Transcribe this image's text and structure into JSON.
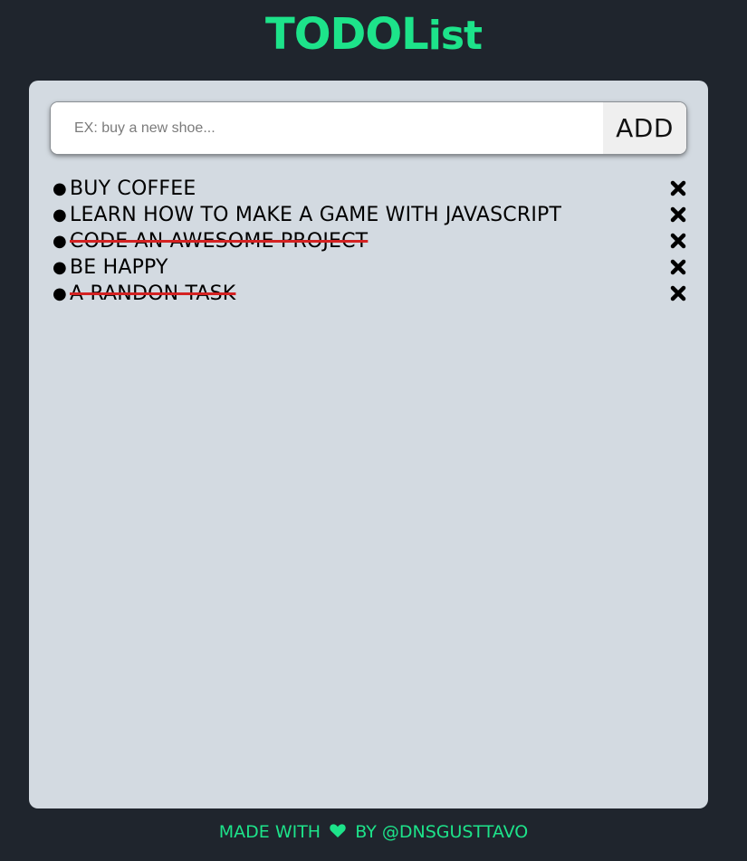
{
  "header": {
    "title_main": "TODOL",
    "title_tail": "ist"
  },
  "form": {
    "placeholder": "EX: buy a new shoe...",
    "value": "",
    "add_label": "ADD"
  },
  "tasks": [
    {
      "text": "BUY COFFEE",
      "done": false
    },
    {
      "text": "LEARN HOW TO MAKE A GAME WITH JAVASCRIPT",
      "done": false
    },
    {
      "text": "CODE AN AWESOME PROJECT",
      "done": true
    },
    {
      "text": "BE HAPPY",
      "done": false
    },
    {
      "text": "A RANDON TASK",
      "done": true
    }
  ],
  "bullet": "●",
  "footer": {
    "prefix": "MADE WITH",
    "heart_icon": "heart-icon",
    "suffix": "BY @DNSGUSTTAVO"
  },
  "colors": {
    "background": "#1f252d",
    "accent": "#1de38a",
    "panel": "#d3dae1",
    "strike": "#d42222"
  }
}
